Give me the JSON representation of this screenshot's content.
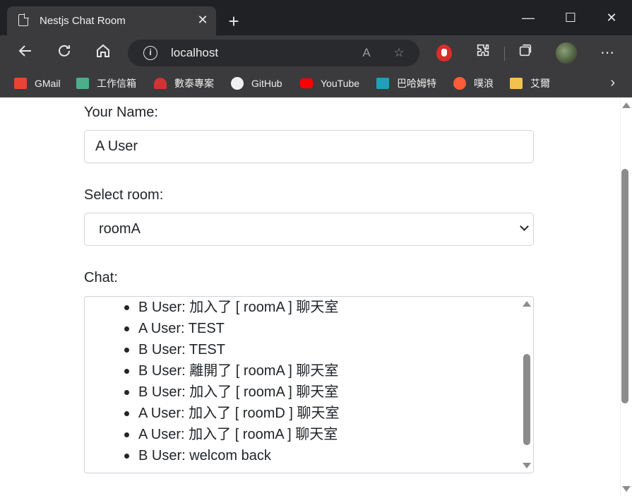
{
  "browser": {
    "tab_title": "Nestjs Chat Room",
    "tab_close": "✕",
    "new_tab": "+",
    "address": "localhost",
    "window_controls": {
      "minimize": "—",
      "maximize": "☐",
      "close": "✕"
    }
  },
  "bookmarks": [
    {
      "label": "GMail",
      "color": "#ea4335"
    },
    {
      "label": "工作信箱",
      "color": "#4caf8a"
    },
    {
      "label": "數泰專案",
      "color": "#d23232"
    },
    {
      "label": "GitHub",
      "color": "#f0f0f0"
    },
    {
      "label": "YouTube",
      "color": "#ff0000"
    },
    {
      "label": "巴哈姆特",
      "color": "#20a0b8"
    },
    {
      "label": "噗浪",
      "color": "#ff5c3a"
    },
    {
      "label": "艾爾",
      "color": "#f3c24d"
    }
  ],
  "form": {
    "name_label": "Your Name:",
    "name_value": "A User",
    "room_label": "Select room:",
    "room_value": "roomA",
    "chat_label": "Chat:"
  },
  "chat_messages": [
    "B User: 加入了 [ roomA ] 聊天室",
    "A User: TEST",
    "B User: TEST",
    "B User: 離開了 [ roomA ] 聊天室",
    "B User: 加入了 [ roomA ] 聊天室",
    "A User: 加入了 [ roomD ] 聊天室",
    "A User: 加入了 [ roomA ] 聊天室",
    "B User: welcom back"
  ],
  "icons": {
    "back": "back-arrow-icon",
    "refresh": "refresh-icon",
    "home": "home-icon",
    "info": "site-info-icon",
    "read_aloud": "read-aloud-icon",
    "favorite": "add-favorite-icon",
    "extensions": "extensions-icon",
    "collections": "collections-icon",
    "menu": "more-menu-icon"
  }
}
